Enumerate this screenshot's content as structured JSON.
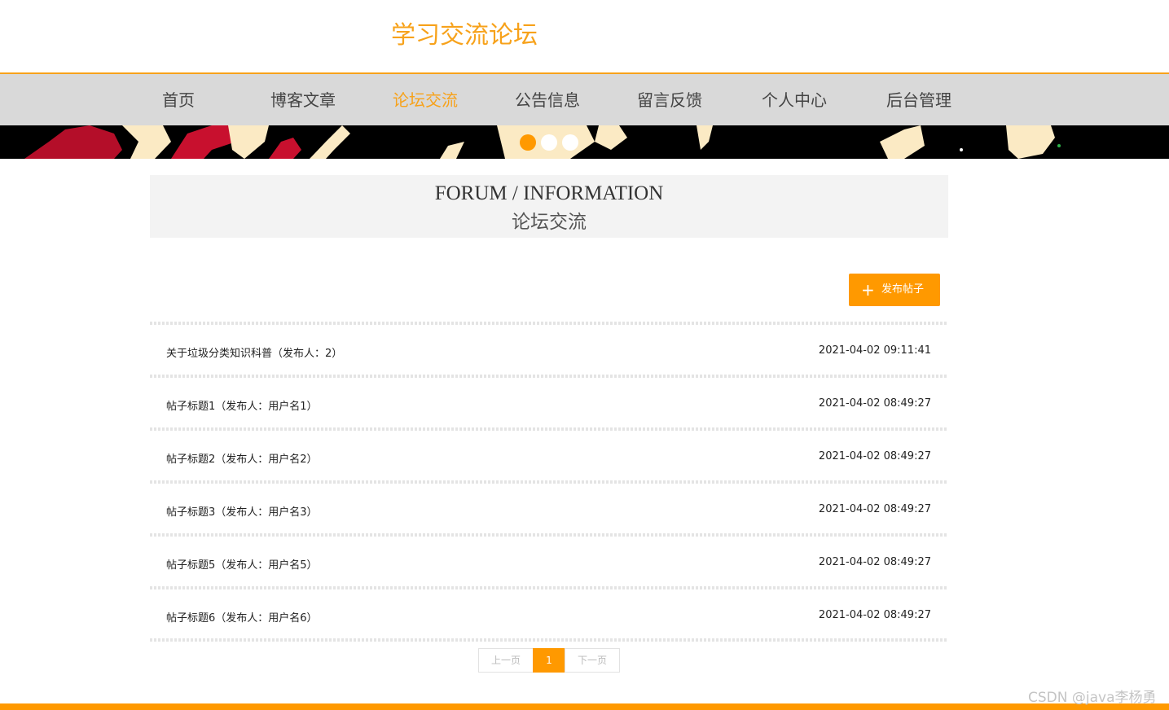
{
  "site": {
    "title": "学习交流论坛"
  },
  "nav": {
    "items": [
      {
        "label": "首页"
      },
      {
        "label": "博客文章"
      },
      {
        "label": "论坛交流"
      },
      {
        "label": "公告信息"
      },
      {
        "label": "留言反馈"
      },
      {
        "label": "个人中心"
      },
      {
        "label": "后台管理"
      }
    ],
    "active": "论坛交流"
  },
  "banner": {
    "slide_count": 3,
    "active_slide": 1
  },
  "section": {
    "title_en": "FORUM / INFORMATION",
    "title_cn": "论坛交流"
  },
  "actions": {
    "post_label": "发布帖子",
    "post_icon": "plus-icon"
  },
  "posts": [
    {
      "title": "关于垃圾分类知识科普（发布人：2）",
      "time": "2021-04-02 09:11:41"
    },
    {
      "title": "帖子标题1（发布人：用户名1）",
      "time": "2021-04-02 08:49:27"
    },
    {
      "title": "帖子标题2（发布人：用户名2）",
      "time": "2021-04-02 08:49:27"
    },
    {
      "title": "帖子标题3（发布人：用户名3）",
      "time": "2021-04-02 08:49:27"
    },
    {
      "title": "帖子标题5（发布人：用户名5）",
      "time": "2021-04-02 08:49:27"
    },
    {
      "title": "帖子标题6（发布人：用户名6）",
      "time": "2021-04-02 08:49:27"
    }
  ],
  "pagination": {
    "prev": "上一页",
    "current": "1",
    "next": "下一页"
  },
  "watermark": "CSDN @java李杨勇",
  "colors": {
    "accent": "#ff9900",
    "title": "#f7a21b",
    "nav_bg": "#d9d9d9",
    "head_bg": "#f3f3f3"
  }
}
